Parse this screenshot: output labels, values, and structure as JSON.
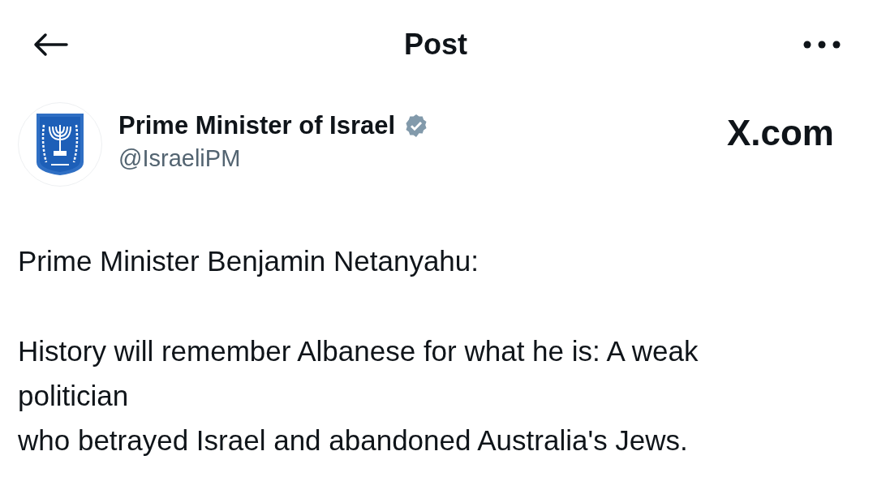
{
  "header": {
    "title": "Post"
  },
  "author": {
    "name": "Prime Minister of Israel",
    "verified": true,
    "handle": "@IsraeliPM"
  },
  "source_label": "X.com",
  "body": [
    "Prime Minister Benjamin Netanyahu:",
    "History will remember Albanese for what he is: A weak politician\nwho betrayed Israel and abandoned Australia's Jews."
  ]
}
